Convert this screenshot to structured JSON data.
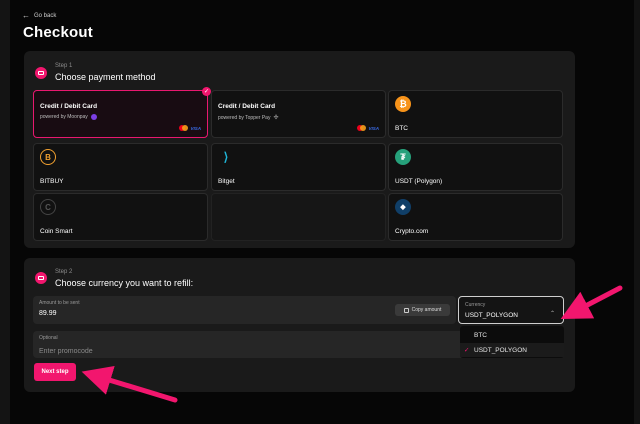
{
  "nav": {
    "back_label": "Go back"
  },
  "page": {
    "title": "Checkout"
  },
  "step1": {
    "label": "Step 1",
    "title": "Choose payment method",
    "methods": [
      {
        "name": "Credit / Debit Card",
        "provider": "powered by Moonpay",
        "selected": true
      },
      {
        "name": "Credit / Debit Card",
        "provider": "powered by Topper Pay",
        "selected": false
      },
      {
        "name": "BTC",
        "icon": "bitcoin-icon"
      },
      {
        "name": "BITBUY",
        "icon": "bitbuy-icon"
      },
      {
        "name": "Bitget",
        "icon": "bitget-icon"
      },
      {
        "name": "USDT (Polygon)",
        "icon": "tether-icon"
      },
      {
        "name": "Coin Smart",
        "icon": "coinsmart-icon"
      },
      {
        "name": "Crypto.com",
        "icon": "cryptocom-icon"
      }
    ],
    "card_brands": {
      "mastercard": "mastercard-icon",
      "visa": "VISA"
    }
  },
  "step2": {
    "label": "Step 2",
    "title": "Choose currency you want to refill:",
    "amount": {
      "label": "Amount to be sent",
      "value": "89.99",
      "copy_label": "Copy amount"
    },
    "currency": {
      "label": "Currency",
      "value": "USDT_POLYGON",
      "options": [
        {
          "label": "BTC",
          "selected": false
        },
        {
          "label": "USDT_POLYGON",
          "selected": true
        }
      ]
    },
    "promo": {
      "label": "Optional",
      "placeholder": "Enter promocode"
    },
    "next_label": "Next step"
  },
  "colors": {
    "accent": "#f2166e",
    "annotation_arrow": "#f2166e"
  }
}
